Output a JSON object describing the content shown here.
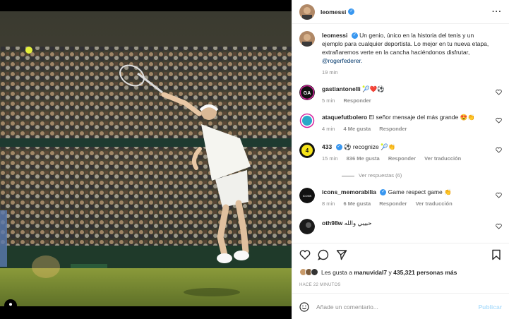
{
  "post": {
    "username": "leomessi",
    "caption_user": "leomessi",
    "caption_text": "Un genio, único en la historia del tenis y un ejemplo para cualquier deportista. Lo mejor en tu nueva etapa, extrañaremos verte en la cancha haciéndonos disfrutar, ",
    "caption_mention": "@rogerfederer.",
    "caption_time": "19 min"
  },
  "comments": [
    {
      "user": "gastiantonelli",
      "text": "🎾❤️⚽",
      "time": "5 min",
      "likes": "",
      "reply": "Responder",
      "translate": ""
    },
    {
      "user": "ataquefutbolero",
      "text": "El señor mensaje del más grande 😍👏",
      "time": "4 min",
      "likes": "4 Me gusta",
      "reply": "Responder",
      "translate": ""
    },
    {
      "user": "433",
      "text": "⚽ recognize 🎾👏",
      "time": "15 min",
      "likes": "836 Me gusta",
      "reply": "Responder",
      "translate": "Ver traducción",
      "view_replies": "Ver respuestas (6)"
    },
    {
      "user": "icons_memorabilia",
      "text": "Game respect game 👏",
      "time": "8 min",
      "likes": "6 Me gusta",
      "reply": "Responder",
      "translate": "Ver traducción"
    },
    {
      "user": "oth98w",
      "text": "حبيبي والله",
      "time": "",
      "likes": "",
      "reply": "",
      "translate": ""
    }
  ],
  "actions": {
    "likes_prefix": "Les gusta a",
    "likes_user": "manuvidal7",
    "likes_and": "y",
    "likes_count": "435,321 personas más",
    "timestamp": "HACE 22 MINUTOS"
  },
  "add_comment": {
    "placeholder": "Añade un comentario...",
    "publish": "Publicar"
  },
  "icons": {
    "more": "more-horizontal-icon",
    "heart": "heart-icon",
    "comment": "comment-icon",
    "share": "share-icon",
    "save": "bookmark-icon",
    "emoji": "emoji-icon",
    "verified": "verified-badge-icon",
    "tag": "user-tag-icon"
  },
  "colors": {
    "verified": "#3897f0",
    "link": "#00376b",
    "publish_disabled": "#b2dffc",
    "heart_red": "#ed4956"
  }
}
